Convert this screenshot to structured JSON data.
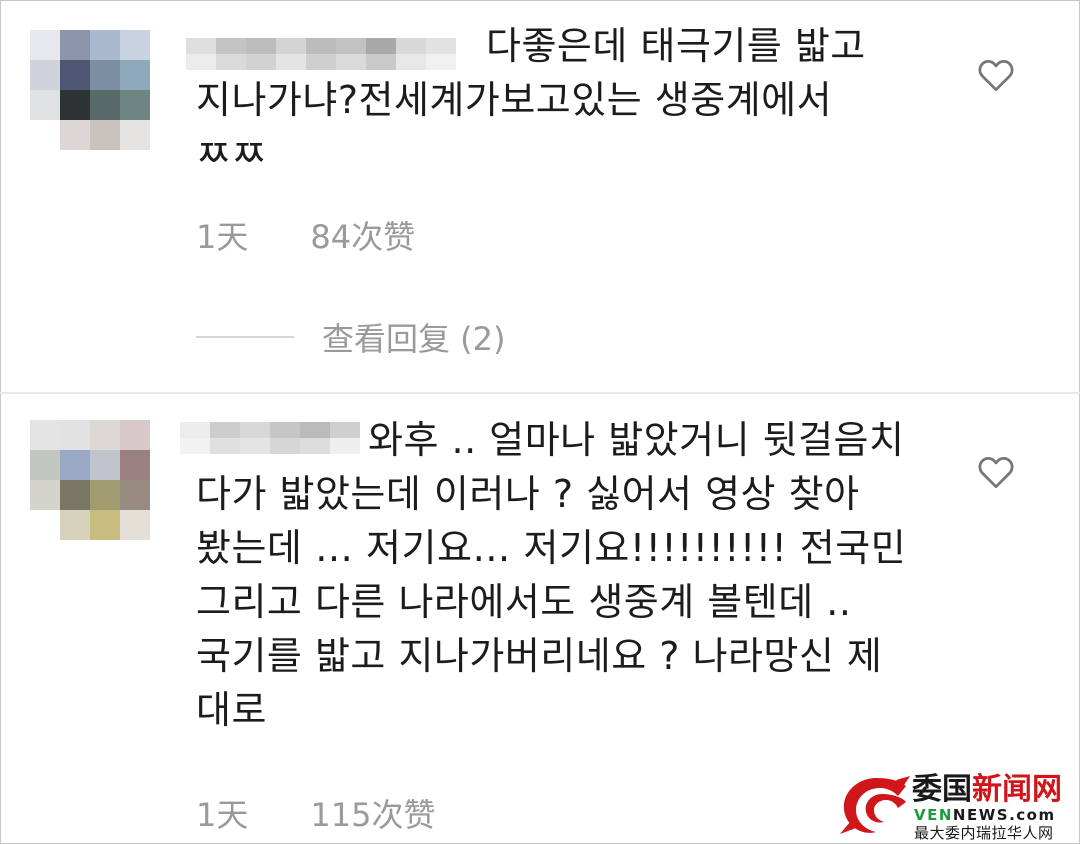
{
  "comments": [
    {
      "lines": [
        "다좋은데 태극기를 밟고",
        "지나가냐?전세계가보고있는 생중계에서",
        "ㅉㅉ"
      ],
      "time": "1天",
      "likes": "84次赞",
      "replies_label": "查看回复 (2)"
    },
    {
      "lines": [
        "와후 .. 얼마나 밟았거니 뒷걸음치",
        "다가 밟았는데 이러나 ? 싫어서 영상 찾아",
        "봤는데 … 저기요… 저기요!!!!!!!!!! 전국민",
        "그리고 다른 나라에서도 생중계 볼텐데 ..",
        "국기를 밟고 지나가버리네요 ? 나라망신 제",
        "대로"
      ],
      "time": "1天",
      "likes": "115次赞"
    }
  ],
  "icons": {
    "like": "heart-outline-icon",
    "watermark": "dragon-logo-icon"
  },
  "watermark": {
    "brand_a": "委国",
    "brand_b": "新闻网",
    "domain_a": "VEN",
    "domain_b": "NEWS",
    "domain_c": ".com",
    "tagline": "最大委内瑞拉华人网"
  },
  "colors": {
    "text": "#1c1c1c",
    "meta": "#9a9a9a",
    "brand_red": "#d0161b",
    "brand_green": "#1f9a3c"
  }
}
